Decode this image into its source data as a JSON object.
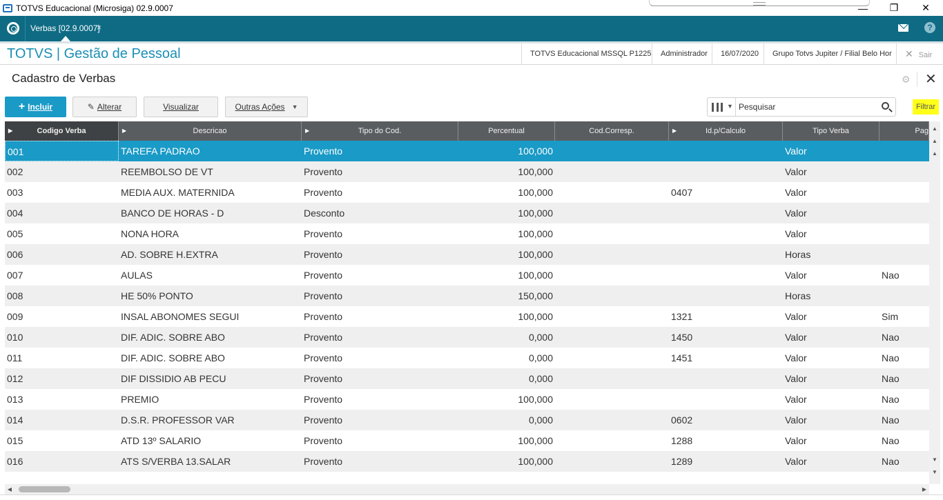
{
  "window": {
    "title": "TOTVS Educacional (Microsiga) 02.9.0007",
    "minimize": "—",
    "restore": "❐",
    "close": "✕"
  },
  "tabbar": {
    "active_tab": "Verbas [02.9.0007]",
    "tab_close": "×",
    "help": "?"
  },
  "module": {
    "title": "TOTVS | Gestão de Pessoal",
    "environment": "TOTVS Educacional MSSQL P1225",
    "user": "Administrador",
    "date": "16/07/2020",
    "company": "Grupo Totvs Jupiter / Filial Belo Hor",
    "exit_icon": "✕",
    "exit_label": "Sair"
  },
  "page": {
    "title": "Cadastro de Verbas",
    "gear_icon": "⚙",
    "close_icon": "✕"
  },
  "toolbar": {
    "include_icon": "+",
    "include_label": "Incluir",
    "edit_label": "Alterar",
    "view_label": "Visualizar",
    "more_label": "Outras Ações",
    "more_caret": "▼"
  },
  "search": {
    "placeholder": "Pesquisar",
    "columns_caret": "▼",
    "filter_label": "Filtrar"
  },
  "grid": {
    "columns": [
      "Codigo Verba",
      "Descricao",
      "Tipo do Cod.",
      "Percentual",
      "Cod.Corresp.",
      "Id.p/Calculo",
      "Tipo Verba",
      "Pag"
    ],
    "sort_arrow": "▶",
    "rows": [
      [
        "001",
        "TAREFA PADRAO",
        "Provento",
        "100,000",
        "",
        "",
        "Valor",
        ""
      ],
      [
        "002",
        "REEMBOLSO DE VT",
        "Provento",
        "100,000",
        "",
        "",
        "Valor",
        ""
      ],
      [
        "003",
        "MEDIA AUX. MATERNIDA",
        "Provento",
        "100,000",
        "",
        "0407",
        "Valor",
        ""
      ],
      [
        "004",
        "BANCO DE HORAS - D",
        "Desconto",
        "100,000",
        "",
        "",
        "Valor",
        ""
      ],
      [
        "005",
        "NONA HORA",
        "Provento",
        "100,000",
        "",
        "",
        "Valor",
        ""
      ],
      [
        "006",
        "AD. SOBRE H.EXTRA",
        "Provento",
        "100,000",
        "",
        "",
        "Horas",
        ""
      ],
      [
        "007",
        "AULAS",
        "Provento",
        "100,000",
        "",
        "",
        "Valor",
        "Nao"
      ],
      [
        "008",
        "HE 50% PONTO",
        "Provento",
        "150,000",
        "",
        "",
        "Horas",
        ""
      ],
      [
        "009",
        "INSAL ABONOMES SEGUI",
        "Provento",
        "100,000",
        "",
        "1321",
        "Valor",
        "Sim"
      ],
      [
        "010",
        "DIF. ADIC. SOBRE ABO",
        "Provento",
        "0,000",
        "",
        "1450",
        "Valor",
        "Nao"
      ],
      [
        "011",
        "DIF. ADIC. SOBRE ABO",
        "Provento",
        "0,000",
        "",
        "1451",
        "Valor",
        "Nao"
      ],
      [
        "012",
        "DIF DISSIDIO AB PECU",
        "Provento",
        "0,000",
        "",
        "",
        "Valor",
        "Nao"
      ],
      [
        "013",
        "PREMIO",
        "Provento",
        "100,000",
        "",
        "",
        "Valor",
        "Nao"
      ],
      [
        "014",
        "D.S.R. PROFESSOR VAR",
        "Provento",
        "0,000",
        "",
        "0602",
        "Valor",
        "Nao"
      ],
      [
        "015",
        "ATD 13º SALARIO",
        "Provento",
        "100,000",
        "",
        "1288",
        "Valor",
        "Nao"
      ],
      [
        "016",
        "ATS S/VERBA 13.SALAR",
        "Provento",
        "100,000",
        "",
        "1289",
        "Valor",
        "Nao"
      ]
    ],
    "selected_row": 0
  },
  "colors": {
    "tabbar": "#0f6b84",
    "accent": "#1a9ac6",
    "module_title": "#1a8fb3",
    "filter_highlight": "#ffff1a",
    "grid_header": "#5a5d60"
  }
}
